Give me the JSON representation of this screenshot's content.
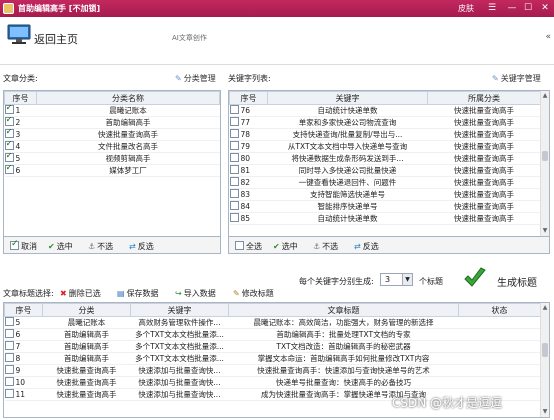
{
  "window": {
    "title": "首助编辑高手 [不加锁]",
    "skin": "皮肤"
  },
  "header": {
    "home": "返回主页",
    "ai": "AI文章创作"
  },
  "article_cat": {
    "label": "文章分类:",
    "manage": "分类管理",
    "columns": [
      "序号",
      "分类名称"
    ],
    "rows": [
      {
        "n": "1",
        "name": "晨曦记账本",
        "checked": true
      },
      {
        "n": "2",
        "name": "首助编辑高手",
        "checked": true
      },
      {
        "n": "3",
        "name": "快速批量查询高手",
        "checked": true
      },
      {
        "n": "4",
        "name": "文件批量改名高手",
        "checked": true
      },
      {
        "n": "5",
        "name": "视频剪辑高手",
        "checked": true
      },
      {
        "n": "6",
        "name": "媒体梦工厂",
        "checked": true
      }
    ],
    "bar": {
      "cancel": "取消",
      "select": "选中",
      "unselect": "不选",
      "invert": "反选"
    }
  },
  "keyword": {
    "label": "关键字列表:",
    "manage": "关键字管理",
    "columns": [
      "序号",
      "关键字",
      "所属分类"
    ],
    "rows": [
      {
        "n": "76",
        "kw": "自动统计快递单数",
        "cat": "快速批量查询高手"
      },
      {
        "n": "77",
        "kw": "单家和多家快递公司物流查询",
        "cat": "快速批量查询高手"
      },
      {
        "n": "78",
        "kw": "支持快递查询/批量复制/导出与...",
        "cat": "快速批量查询高手"
      },
      {
        "n": "79",
        "kw": "从TXT文本文档中导入快递单号查询",
        "cat": "快速批量查询高手"
      },
      {
        "n": "80",
        "kw": "将快递数据生成条形码发送到手...",
        "cat": "快速批量查询高手"
      },
      {
        "n": "81",
        "kw": "同时导入多快递公司批量快递",
        "cat": "快速批量查询高手"
      },
      {
        "n": "82",
        "kw": "一键查看快递退回件、问题件",
        "cat": "快速批量查询高手"
      },
      {
        "n": "83",
        "kw": "支持智能筛选快递单号",
        "cat": "快速批量查询高手"
      },
      {
        "n": "84",
        "kw": "智能排序快递单号",
        "cat": "快速批量查询高手"
      },
      {
        "n": "85",
        "kw": "自动统计快递单数",
        "cat": "快速批量查询高手"
      }
    ],
    "bar": {
      "all": "全选",
      "select": "选中",
      "unselect": "不选",
      "invert": "反选"
    }
  },
  "titles": {
    "label": "文章标题选择:",
    "delete": "删除已选",
    "save": "保存数据",
    "import": "导入数据",
    "edit": "修改标题",
    "per_label": "每个关键字分别生成:",
    "per_value": "3",
    "per_unit": "个标题",
    "generate": "生成标题",
    "columns": [
      "序号",
      "分类",
      "关键字",
      "文章标题",
      "状态"
    ],
    "rows": [
      {
        "n": "5",
        "cat": "晨曦记账本",
        "kw": "高效财务管理软件操作...",
        "title": "晨曦记账本：高效简洁，功能强大，财务管理的新选择",
        "st": ""
      },
      {
        "n": "6",
        "cat": "首助编辑高手",
        "kw": "多个TXT文本文档批量添...",
        "title": "首助编辑高手：批量处理TXT文档的专家",
        "st": ""
      },
      {
        "n": "7",
        "cat": "首助编辑高手",
        "kw": "多个TXT文本文档批量添...",
        "title": "TXT文档改造：首助编辑高手的秘密武器",
        "st": ""
      },
      {
        "n": "8",
        "cat": "首助编辑高手",
        "kw": "多个TXT文本文档批量添...",
        "title": "掌握文本命运：首助编辑高手如何批量修改TXT内容",
        "st": ""
      },
      {
        "n": "9",
        "cat": "快速批量查询高手",
        "kw": "快速添加与批量查询快...",
        "title": "快速批量查询高手：快速添加与查询快递单号的艺术",
        "st": ""
      },
      {
        "n": "10",
        "cat": "快速批量查询高手",
        "kw": "快速添加与批量查询快...",
        "title": "快递单号批量查询：快速高手的必备技巧",
        "st": ""
      },
      {
        "n": "11",
        "cat": "快速批量查询高手",
        "kw": "快速添加与批量查询快...",
        "title": "成为快速批量查询高手：掌握快递单号添加与查询",
        "st": ""
      }
    ]
  },
  "watermark": "CSDN @秋才是逗逗"
}
